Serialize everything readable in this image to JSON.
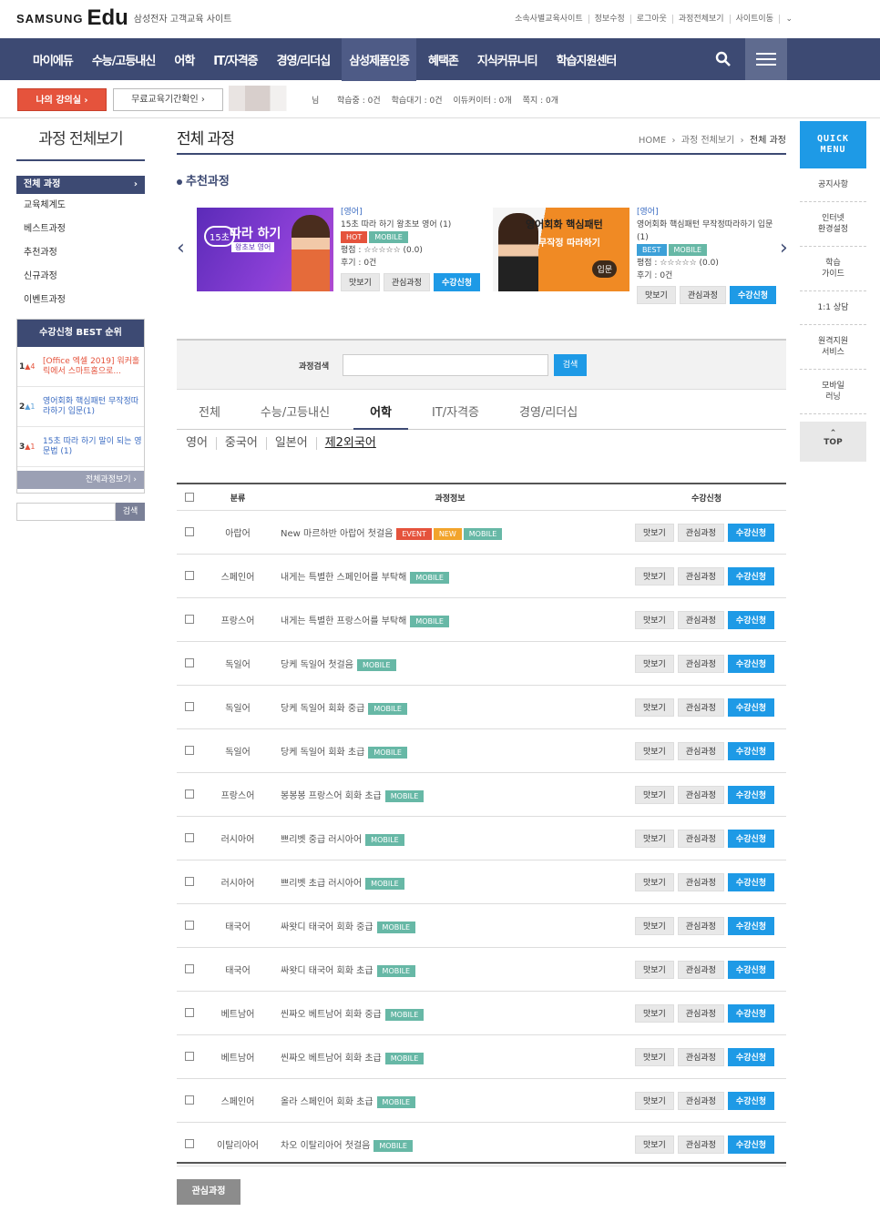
{
  "header": {
    "brand1": "SAMSUNG",
    "brand2": "Edu",
    "brand_sub": "삼성전자 고객교육 사이트",
    "util": [
      "소속사별교육사이트",
      "정보수정",
      "로그아웃",
      "과정전체보기",
      "사이트이동"
    ]
  },
  "gnb": {
    "items": [
      "마이에듀",
      "수능/고등내신",
      "어학",
      "IT/자격증",
      "경영/리더십",
      "삼성제품인증",
      "혜택존",
      "지식커뮤니티",
      "학습지원센터"
    ],
    "active": 5
  },
  "subbar": {
    "my_label": "나의 강의실 ›",
    "free_label": "무료교육기간확인 ›",
    "suffix": "님",
    "stats": [
      "학습중 : 0건",
      "학습대기 : 0건",
      "이듀커이터 : 0개",
      "쪽지 : 0개"
    ]
  },
  "lnb": {
    "title": "과정 전체보기",
    "items": [
      "전체 과정",
      "교육체계도",
      "베스트과정",
      "추천과정",
      "신규과정",
      "이벤트과정"
    ]
  },
  "best": {
    "title": "수강신청 BEST 순위",
    "rows": [
      {
        "rank": "1",
        "delta": "4",
        "text": "[Office 엑셀 2019] 워커홀릭에서 스마트홈으로..."
      },
      {
        "rank": "2",
        "delta": "1",
        "text": "영어회화 핵심패턴 무작정따라하기 입문(1)"
      },
      {
        "rank": "3",
        "delta": "1",
        "text": "15초 따라 하기 말이 되는 영문법 (1)"
      }
    ],
    "more": "전체과정보기 ›"
  },
  "lsearch": {
    "button": "검색"
  },
  "main": {
    "title": "전체 과정",
    "breadcrumb": [
      "HOME",
      "과정 전체보기",
      "전체 과정"
    ],
    "rec_title": "추천과정",
    "cards": [
      {
        "cat": "[영어]",
        "name": "15초 따라 하기 왕초보 영어 (1)",
        "tags": [
          "HOT",
          "MOBILE"
        ],
        "rating": "평점 : ☆☆☆☆☆ (0.0)",
        "review": "후기 : 0건",
        "thumb_text": "따라 하기",
        "thumb_sub": "왕초보 영어",
        "thumb_badge": "15초"
      },
      {
        "cat": "[영어]",
        "name": "영어회화 핵심패턴 무작정따라하기 입문(1)",
        "tags": [
          "BEST",
          "MOBILE"
        ],
        "rating": "평점 : ☆☆☆☆☆ (0.0)",
        "review": "후기 : 0건",
        "thumb_text": "영어회화 핵심패턴",
        "thumb_sub": "무작정 따라하기",
        "thumb_badge": "입문"
      }
    ],
    "card_btns": [
      "맛보기",
      "관심과정",
      "수강신청"
    ],
    "search": {
      "label": "과정검색",
      "button": "검색"
    },
    "tabs": [
      "전체",
      "수능/고등내신",
      "어학",
      "IT/자격증",
      "경영/리더십"
    ],
    "active_tab": 2,
    "subtabs": [
      "영어",
      "중국어",
      "일본어",
      "제2외국어"
    ],
    "active_sub": 3,
    "table_head": [
      "분류",
      "과정정보",
      "수강신청"
    ],
    "rows": [
      {
        "cat": "아랍어",
        "name": "New 마르하반 아랍어 첫걸음",
        "tags": [
          "EVENT",
          "NEW",
          "MOBILE"
        ]
      },
      {
        "cat": "스페인어",
        "name": "내게는 특별한 스페인어를 부탁해",
        "tags": [
          "MOBILE"
        ]
      },
      {
        "cat": "프랑스어",
        "name": "내게는 특별한 프랑스어를 부탁해",
        "tags": [
          "MOBILE"
        ]
      },
      {
        "cat": "독일어",
        "name": "당케 독일어 첫걸음",
        "tags": [
          "MOBILE"
        ]
      },
      {
        "cat": "독일어",
        "name": "당케 독일어 회화 중급",
        "tags": [
          "MOBILE"
        ]
      },
      {
        "cat": "독일어",
        "name": "당케 독일어 회화 초급",
        "tags": [
          "MOBILE"
        ]
      },
      {
        "cat": "프랑스어",
        "name": "봉봉봉 프랑스어 회화 초급",
        "tags": [
          "MOBILE"
        ]
      },
      {
        "cat": "러시아어",
        "name": "쁘리벳 중급 러시아어",
        "tags": [
          "MOBILE"
        ]
      },
      {
        "cat": "러시아어",
        "name": "쁘리벳 초급 러시아어",
        "tags": [
          "MOBILE"
        ]
      },
      {
        "cat": "태국어",
        "name": "싸왓디 태국어 회화 중급",
        "tags": [
          "MOBILE"
        ]
      },
      {
        "cat": "태국어",
        "name": "싸왓디 태국어 회화 초급",
        "tags": [
          "MOBILE"
        ]
      },
      {
        "cat": "베트남어",
        "name": "씬짜오 베트남어 회화 중급",
        "tags": [
          "MOBILE"
        ]
      },
      {
        "cat": "베트남어",
        "name": "씬짜오 베트남어 회화 초급",
        "tags": [
          "MOBILE"
        ]
      },
      {
        "cat": "스페인어",
        "name": "올라 스페인어 회화 초급",
        "tags": [
          "MOBILE"
        ]
      },
      {
        "cat": "이탈리아어",
        "name": "차오 이탈리아어 첫걸음",
        "tags": [
          "MOBILE"
        ]
      }
    ],
    "fav_button": "관심과정"
  },
  "quick": {
    "title1": "QUICK",
    "title2": "MENU",
    "items": [
      "공지사항",
      "인터넷\n환경설정",
      "학습\n가이드",
      "1:1 상담",
      "원격지원\n서비스",
      "모바일\n러닝"
    ],
    "top": "TOP"
  },
  "colors": {
    "navy": "#3d4a73",
    "blue": "#1e9ae6",
    "red": "#e5533c",
    "mobile": "#67b8a6"
  }
}
